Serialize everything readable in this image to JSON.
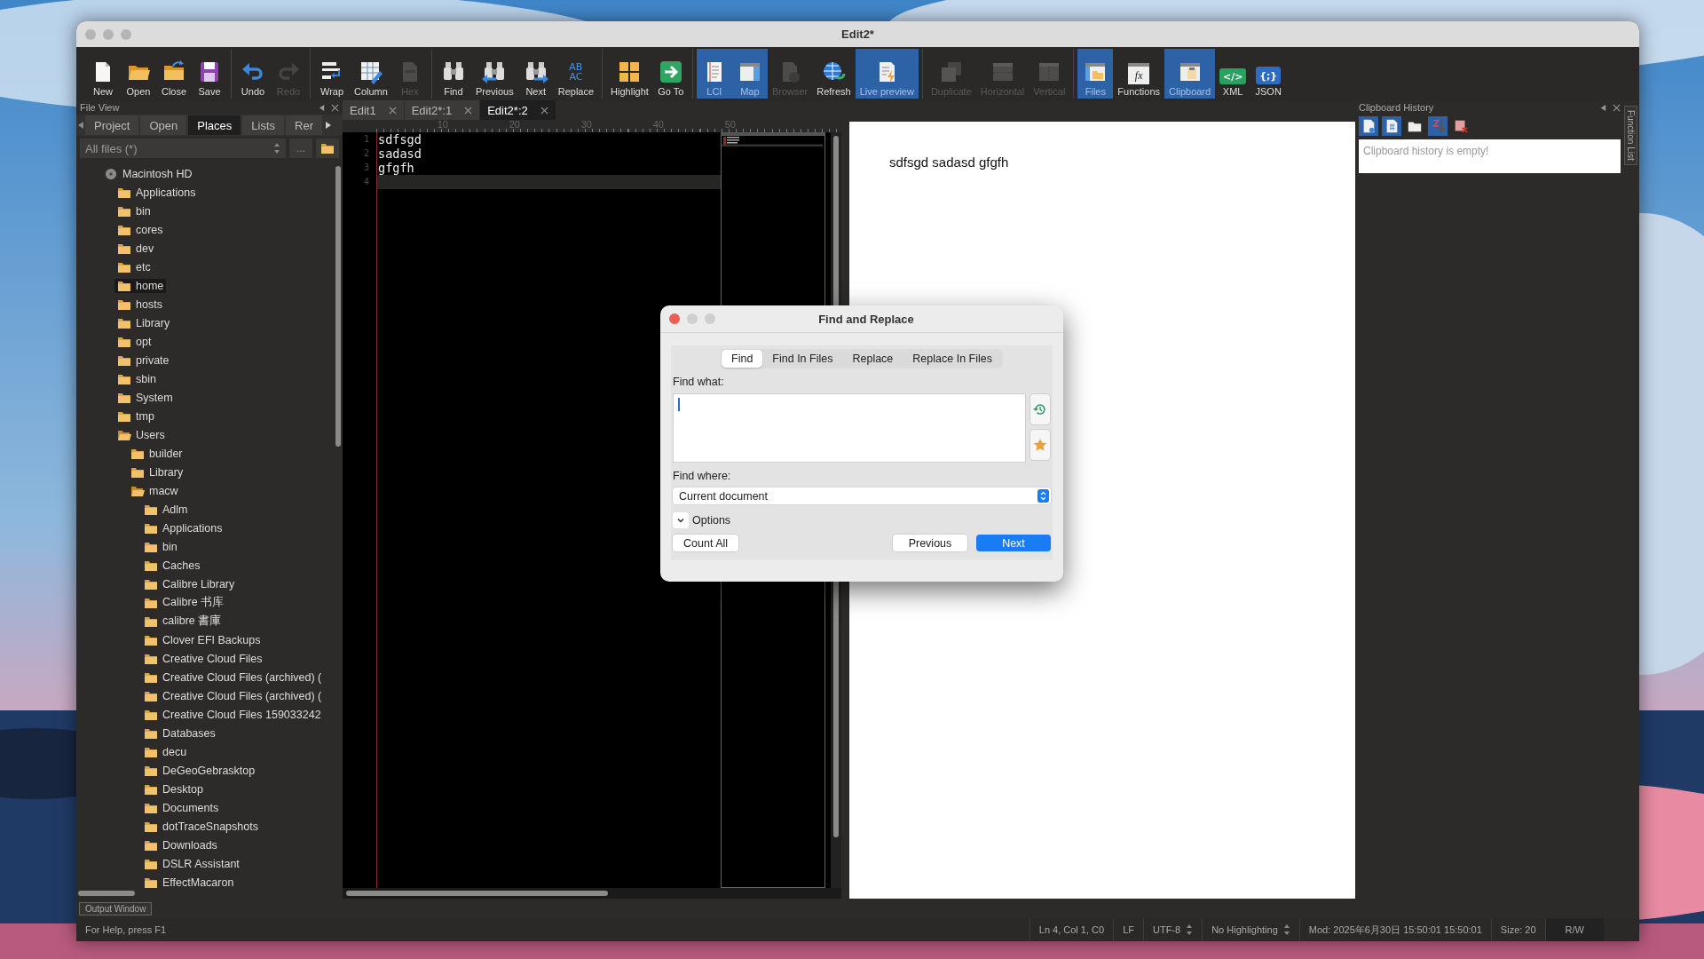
{
  "window": {
    "title": "Edit2*"
  },
  "toolbar": [
    {
      "items": [
        {
          "label": "New",
          "active": false,
          "disabled": false
        },
        {
          "label": "Open",
          "active": false,
          "disabled": false
        },
        {
          "label": "Close",
          "active": false,
          "disabled": false
        },
        {
          "label": "Save",
          "active": false,
          "disabled": false
        }
      ]
    },
    {
      "items": [
        {
          "label": "Undo",
          "active": false,
          "disabled": false
        },
        {
          "label": "Redo",
          "active": false,
          "disabled": true
        }
      ]
    },
    {
      "items": [
        {
          "label": "Wrap",
          "active": false,
          "disabled": false
        },
        {
          "label": "Column",
          "active": false,
          "disabled": false
        },
        {
          "label": "Hex",
          "active": false,
          "disabled": true
        }
      ]
    },
    {
      "items": [
        {
          "label": "Find",
          "active": false,
          "disabled": false
        },
        {
          "label": "Previous",
          "active": false,
          "disabled": false
        },
        {
          "label": "Next",
          "active": false,
          "disabled": false
        },
        {
          "label": "Replace",
          "active": false,
          "disabled": false,
          "glyphs": [
            "AB",
            "AC"
          ]
        }
      ]
    },
    {
      "items": [
        {
          "label": "Highlight",
          "active": false,
          "disabled": false
        },
        {
          "label": "Go To",
          "active": false,
          "disabled": false
        }
      ]
    },
    {
      "items": [
        {
          "label": "LCI",
          "active": true,
          "disabled": false
        },
        {
          "label": "Map",
          "active": true,
          "disabled": false
        },
        {
          "label": "Browser",
          "active": false,
          "disabled": true
        },
        {
          "label": "Refresh",
          "active": false,
          "disabled": false
        },
        {
          "label": "Live preview",
          "active": true,
          "disabled": false
        }
      ]
    },
    {
      "items": [
        {
          "label": "Duplicate",
          "active": false,
          "disabled": true
        },
        {
          "label": "Horizontal",
          "active": false,
          "disabled": true
        },
        {
          "label": "Vertical",
          "active": false,
          "disabled": true
        }
      ]
    },
    {
      "items": [
        {
          "label": "Files",
          "active": true,
          "disabled": false
        },
        {
          "label": "Functions",
          "active": false,
          "disabled": false,
          "glyphs": [
            "fx"
          ]
        },
        {
          "label": "Clipboard",
          "active": true,
          "disabled": false
        },
        {
          "label": "XML",
          "active": false,
          "disabled": false,
          "glyphs": [
            "</>"
          ]
        },
        {
          "label": "JSON",
          "active": false,
          "disabled": false,
          "glyphs": [
            "{;}"
          ]
        }
      ]
    }
  ],
  "file_view": {
    "title": "File View",
    "tabs": [
      {
        "label": "Project",
        "selected": false
      },
      {
        "label": "Open",
        "selected": false
      },
      {
        "label": "Places",
        "selected": true
      },
      {
        "label": "Lists",
        "selected": false
      },
      {
        "label": "Rer",
        "selected": false
      }
    ],
    "filter": "All files (*)",
    "browse_button": "...",
    "tree": [
      {
        "label": "Macintosh HD",
        "kind": "drive",
        "selected": false,
        "children": [
          {
            "label": "Applications",
            "kind": "folder",
            "expanded": false,
            "selected": false
          },
          {
            "label": "bin",
            "kind": "folder",
            "expanded": false,
            "selected": false
          },
          {
            "label": "cores",
            "kind": "folder",
            "expanded": false,
            "selected": false
          },
          {
            "label": "dev",
            "kind": "folder",
            "expanded": false,
            "selected": false
          },
          {
            "label": "etc",
            "kind": "folder",
            "expanded": false,
            "selected": false
          },
          {
            "label": "home",
            "kind": "folder",
            "expanded": false,
            "selected": true
          },
          {
            "label": "hosts",
            "kind": "folder",
            "expanded": false,
            "selected": false
          },
          {
            "label": "Library",
            "kind": "folder",
            "expanded": false,
            "selected": false
          },
          {
            "label": "opt",
            "kind": "folder",
            "expanded": false,
            "selected": false
          },
          {
            "label": "private",
            "kind": "folder",
            "expanded": false,
            "selected": false
          },
          {
            "label": "sbin",
            "kind": "folder",
            "expanded": false,
            "selected": false
          },
          {
            "label": "System",
            "kind": "folder",
            "expanded": false,
            "selected": false
          },
          {
            "label": "tmp",
            "kind": "folder",
            "expanded": false,
            "selected": false
          },
          {
            "label": "Users",
            "kind": "folder",
            "expanded": true,
            "selected": false,
            "children": [
              {
                "label": "builder",
                "kind": "folder",
                "expanded": false,
                "selected": false
              },
              {
                "label": "Library",
                "kind": "folder",
                "expanded": false,
                "selected": false
              },
              {
                "label": "macw",
                "kind": "folder",
                "expanded": true,
                "selected": false,
                "children": [
                  {
                    "label": "Adlm",
                    "kind": "folder",
                    "expanded": false,
                    "selected": false
                  },
                  {
                    "label": "Applications",
                    "kind": "folder",
                    "expanded": false,
                    "selected": false
                  },
                  {
                    "label": "bin",
                    "kind": "folder",
                    "expanded": false,
                    "selected": false
                  },
                  {
                    "label": "Caches",
                    "kind": "folder",
                    "expanded": false,
                    "selected": false
                  },
                  {
                    "label": "Calibre Library",
                    "kind": "folder",
                    "expanded": false,
                    "selected": false
                  },
                  {
                    "label": "Calibre 书库",
                    "kind": "folder",
                    "expanded": false,
                    "selected": false
                  },
                  {
                    "label": "calibre 書庫",
                    "kind": "folder",
                    "expanded": false,
                    "selected": false
                  },
                  {
                    "label": "Clover EFI Backups",
                    "kind": "folder",
                    "expanded": false,
                    "selected": false
                  },
                  {
                    "label": "Creative Cloud Files",
                    "kind": "folder",
                    "expanded": false,
                    "selected": false
                  },
                  {
                    "label": "Creative Cloud Files (archived) (",
                    "kind": "folder",
                    "expanded": false,
                    "selected": false
                  },
                  {
                    "label": "Creative Cloud Files (archived) (",
                    "kind": "folder",
                    "expanded": false,
                    "selected": false
                  },
                  {
                    "label": "Creative Cloud Files 159033242",
                    "kind": "folder",
                    "expanded": false,
                    "selected": false
                  },
                  {
                    "label": "Databases",
                    "kind": "folder",
                    "expanded": false,
                    "selected": false
                  },
                  {
                    "label": "decu",
                    "kind": "folder",
                    "expanded": false,
                    "selected": false
                  },
                  {
                    "label": "DeGeoGebrasktop",
                    "kind": "folder",
                    "expanded": false,
                    "selected": false
                  },
                  {
                    "label": "Desktop",
                    "kind": "folder",
                    "expanded": false,
                    "selected": false
                  },
                  {
                    "label": "Documents",
                    "kind": "folder",
                    "expanded": false,
                    "selected": false
                  },
                  {
                    "label": "dotTraceSnapshots",
                    "kind": "folder",
                    "expanded": false,
                    "selected": false
                  },
                  {
                    "label": "Downloads",
                    "kind": "folder",
                    "expanded": false,
                    "selected": false
                  },
                  {
                    "label": "DSLR Assistant",
                    "kind": "folder",
                    "expanded": false,
                    "selected": false
                  },
                  {
                    "label": "EffectMacaron",
                    "kind": "folder",
                    "expanded": false,
                    "selected": false
                  }
                ]
              }
            ]
          }
        ]
      }
    ]
  },
  "editor": {
    "tabs": [
      {
        "label": "Edit1",
        "selected": false
      },
      {
        "label": "Edit2*:1",
        "selected": false
      },
      {
        "label": "Edit2*:2",
        "selected": true
      }
    ],
    "ruler": [
      "10",
      "20",
      "30",
      "40",
      "50"
    ],
    "lines": [
      {
        "number": "1",
        "text": "sdfsgd",
        "current": false
      },
      {
        "number": "2",
        "text": "sadasd",
        "current": false
      },
      {
        "number": "3",
        "text": "gfgfh",
        "current": false
      },
      {
        "number": "4",
        "current": true
      }
    ]
  },
  "preview": {
    "text": "sdfsgd sadasd gfgfh"
  },
  "clipboard_panel": {
    "title": "Clipboard History",
    "tools": [
      {
        "active": true
      },
      {
        "active": true
      },
      {
        "active": false
      },
      {
        "active": true
      },
      {
        "active": false
      }
    ],
    "empty_message": "Clipboard history is empty!"
  },
  "side_tab": "Function List",
  "output_tab": "Output Window",
  "status_bar": [
    {
      "text": "For Help, press F1",
      "kind": "text"
    },
    {
      "text": "Ln 4, Col 1, C0",
      "kind": "text"
    },
    {
      "text": "LF",
      "kind": "text"
    },
    {
      "text": "UTF-8",
      "kind": "dropdown"
    },
    {
      "text": "No Highlighting",
      "kind": "dropdown"
    },
    {
      "text": "Mod: 2025年6月30日 15:50:01 15:50:01",
      "kind": "text"
    },
    {
      "text": "Size: 20",
      "kind": "text"
    },
    {
      "text": "R/W",
      "kind": "badge"
    }
  ],
  "dialog": {
    "title": "Find and Replace",
    "tabs": [
      {
        "label": "Find",
        "selected": true
      },
      {
        "label": "Find In Files",
        "selected": false
      },
      {
        "label": "Replace",
        "selected": false
      },
      {
        "label": "Replace In Files",
        "selected": false
      }
    ],
    "find_what_label": "Find what:",
    "find_where_label": "Find where:",
    "find_where_value": "Current document",
    "options_label": "Options",
    "options_expanded": false,
    "buttons": [
      {
        "label": "Count All",
        "kind": "secondary"
      },
      {
        "label": "Previous",
        "kind": "secondary"
      },
      {
        "label": "Next",
        "kind": "primary"
      }
    ]
  }
}
